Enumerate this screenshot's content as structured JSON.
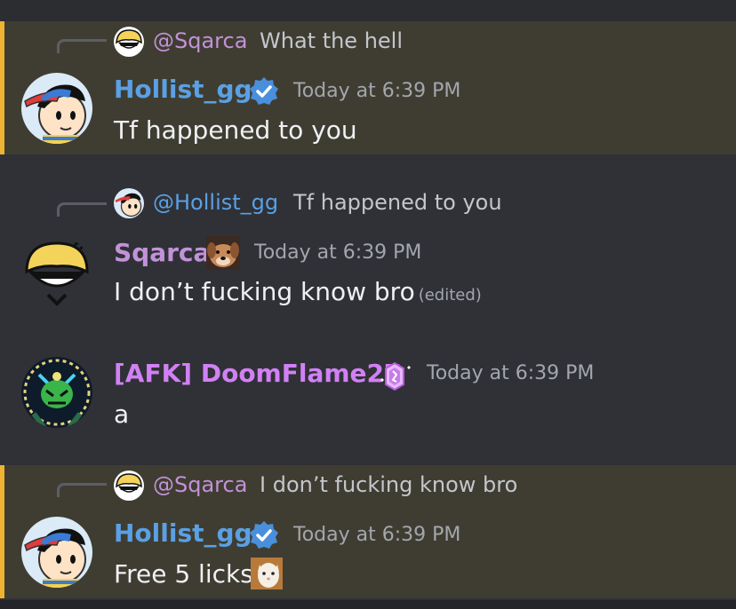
{
  "messages": [
    {
      "author": "Hollist_gg",
      "timestamp": "Today at 6:39 PM",
      "content": "Tf happened to you",
      "reply": {
        "author": "@Sqarca",
        "text": "What the hell"
      },
      "mentioned": true
    },
    {
      "author": "Sqarca",
      "timestamp": "Today at 6:39 PM",
      "content": "I don’t fucking know bro",
      "edited": "(edited)",
      "reply": {
        "author": "@Hollist_gg",
        "text": "Tf happened to you"
      },
      "mentioned": false
    },
    {
      "author": "[AFK] DoomFlame27",
      "timestamp": "Today at 6:39 PM",
      "content": "a",
      "mentioned": false
    },
    {
      "author": "Hollist_gg",
      "timestamp": "Today at 6:39 PM",
      "content": "Free 5 licks",
      "reply": {
        "author": "@Sqarca",
        "text": "I don’t fucking know bro"
      },
      "mentioned": true
    }
  ],
  "icons": {
    "verified": "verified-checkmark-icon",
    "role_badge": "crystal-badge-icon",
    "custom_emoji": "cat-emoji-icon"
  },
  "colors": {
    "background": "#2f3136",
    "mention_highlight": "#3f3d32",
    "mention_bar": "#f0b232",
    "name_hollist": "#5aa0e4",
    "name_sqarca": "#c292d8",
    "name_doomflame": "#d180f5"
  }
}
